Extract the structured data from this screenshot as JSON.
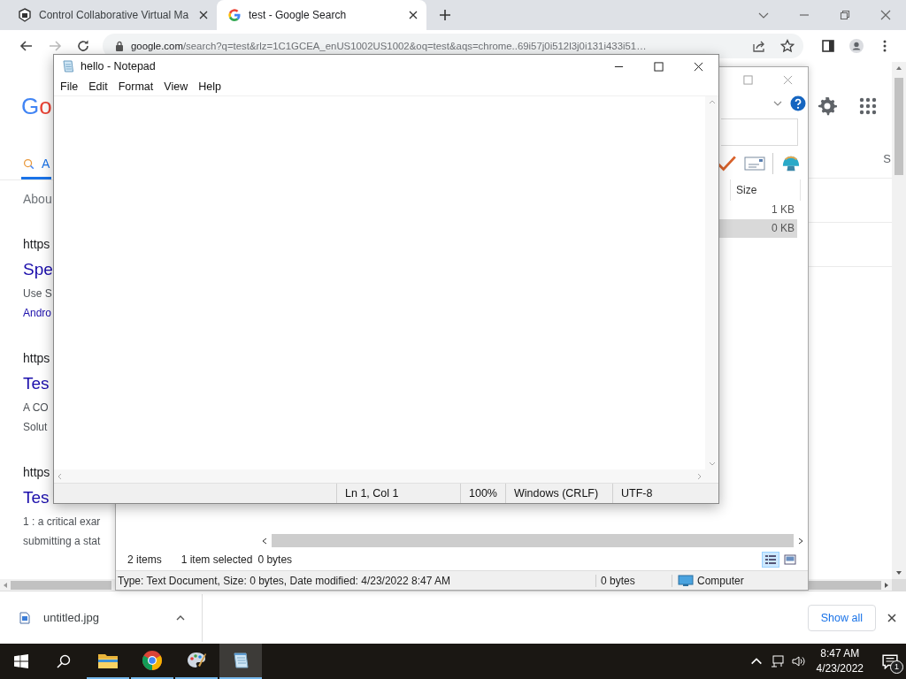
{
  "browser": {
    "tabs": [
      {
        "title": "Control Collaborative Virtual Ma",
        "selected": false,
        "kind": "app"
      },
      {
        "title": "test - Google Search",
        "selected": true,
        "kind": "google"
      }
    ],
    "forward_disabled": true,
    "url_host": "google.com",
    "url_path": "/search?q=test&rlz=1C1GCEA_enUS1002US1002&oq=test&aqs=chrome..69i57j0i512l3j0i131i433i51…",
    "page": {
      "logo": "Go",
      "search_tab": "A",
      "right_tab": "S",
      "about": "Abou",
      "results": [
        {
          "url": "https",
          "title": "Spe",
          "lines": [
            {
              "text": "Use S",
              "link": false
            },
            {
              "text": "Andro",
              "link": true
            }
          ]
        },
        {
          "url": "https",
          "title": "Tes",
          "lines": [
            {
              "text": "A CO",
              "link": false
            },
            {
              "text": "Solut",
              "link": false
            }
          ]
        },
        {
          "url": "https",
          "title": "Tes",
          "lines": [
            {
              "text": "1 : a critical exar",
              "link": false
            },
            {
              "text": "submitting a stat",
              "link": false
            }
          ]
        }
      ]
    },
    "download": {
      "file": "untitled.jpg",
      "show_all": "Show all"
    }
  },
  "explorer": {
    "column": "Size",
    "rows": [
      {
        "size": "1 KB",
        "selected": false
      },
      {
        "size": "0 KB",
        "selected": true
      }
    ],
    "item_count": "2 items",
    "selection": "1 item selected",
    "selection_size": "0 bytes",
    "views": [
      {
        "kind": "details",
        "selected": true
      },
      {
        "kind": "preview",
        "selected": false
      }
    ],
    "status": {
      "details": "Type: Text Document, Size: 0 bytes, Date modified: 4/23/2022 8:47 AM",
      "size": "0 bytes",
      "location": "Computer"
    }
  },
  "notepad": {
    "title": "hello - Notepad",
    "menu": [
      "File",
      "Edit",
      "Format",
      "View",
      "Help"
    ],
    "status": [
      "Ln 1, Col 1",
      "100%",
      "Windows (CRLF)",
      "UTF-8"
    ]
  },
  "taskbar": {
    "apps": [
      {
        "kind": "explorer",
        "running": true,
        "selected": false
      },
      {
        "kind": "chrome",
        "running": true,
        "selected": false
      },
      {
        "kind": "paint",
        "running": true,
        "selected": false
      },
      {
        "kind": "notepad",
        "running": true,
        "selected": true
      }
    ],
    "time": "8:47 AM",
    "date": "4/23/2022",
    "notifications": "1"
  }
}
